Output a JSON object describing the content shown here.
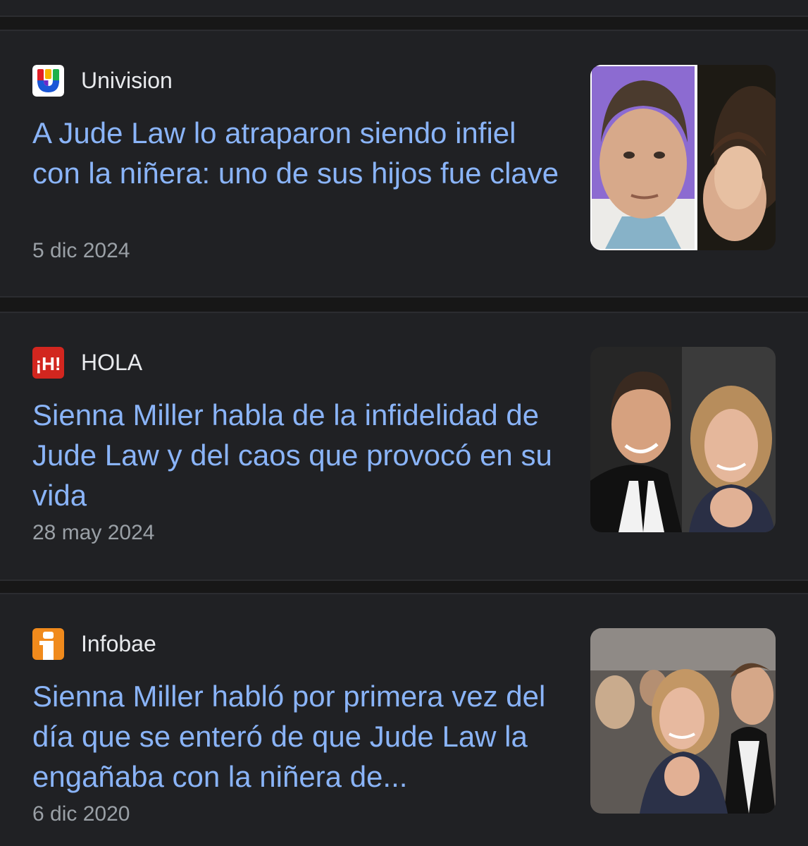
{
  "articles": [
    {
      "source": "Univision",
      "source_logo": "univision-logo-icon",
      "headline": "A Jude Law lo atraparon siendo infiel con la niñera: uno de sus hijos fue clave",
      "date": "5 dic 2024",
      "thumbnail": "jude-law-and-nanny-photo"
    },
    {
      "source": "HOLA",
      "source_logo": "hola-logo-icon",
      "logo_text": "¡H!",
      "headline": "Sienna Miller habla de la infidelidad de Jude Law y del caos que provocó en su vida",
      "date": "28 may 2024",
      "thumbnail": "jude-law-and-sienna-miller-photo"
    },
    {
      "source": "Infobae",
      "source_logo": "infobae-logo-icon",
      "headline": "Sienna Miller habló por primera vez del día que se enteró de que Jude Law la engañaba con la niñera de...",
      "date": "6 dic 2020",
      "thumbnail": "sienna-miller-and-jude-law-event-photo"
    }
  ],
  "colors": {
    "background": "#171717",
    "card": "#202124",
    "headline": "#8ab4f8",
    "source_text": "#e8eaed",
    "date_text": "#9aa0a6",
    "hola_red": "#d2261f",
    "infobae_orange": "#f08a1c"
  }
}
